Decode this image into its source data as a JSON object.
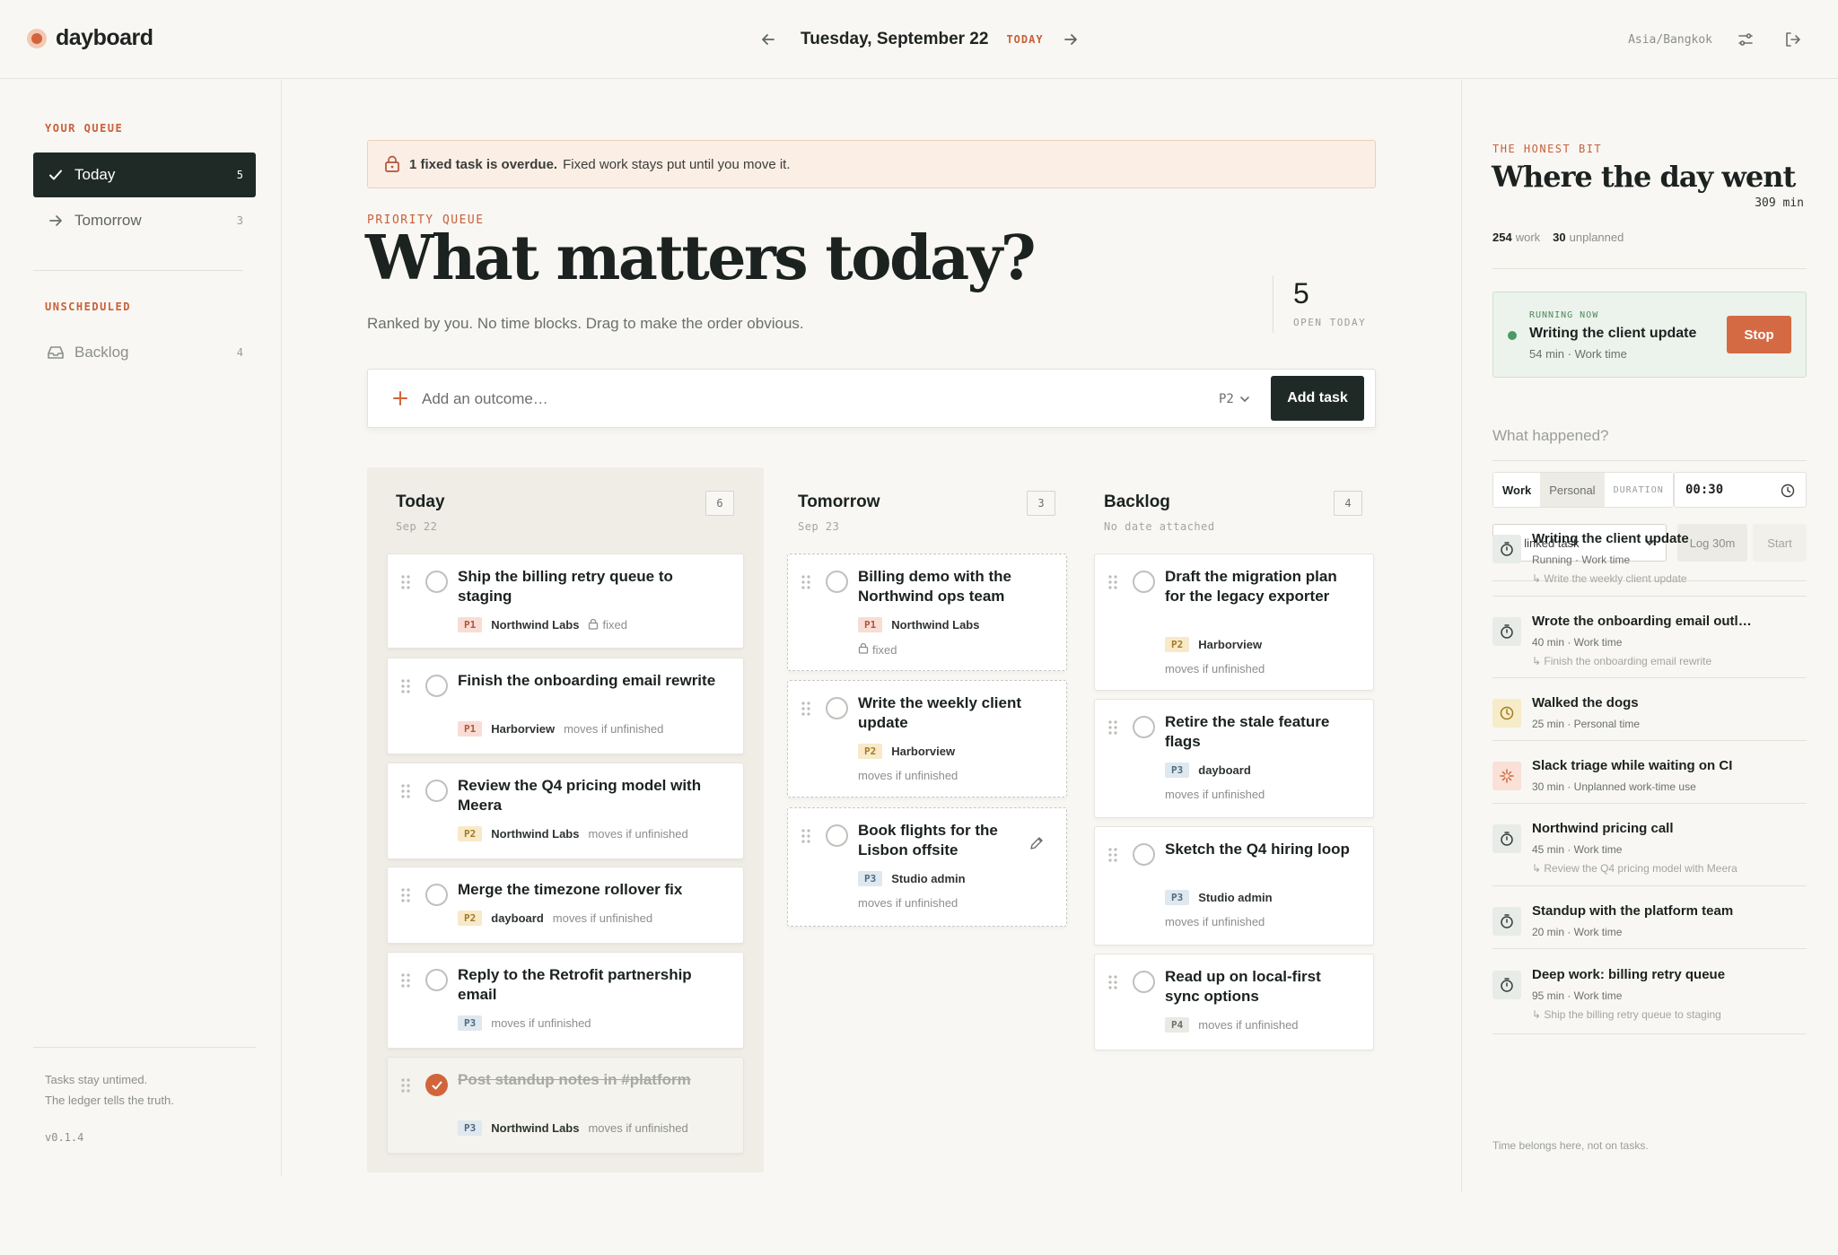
{
  "app": {
    "name": "dayboard"
  },
  "header": {
    "date": "Tuesday, September 22",
    "today_tag": "TODAY",
    "timezone": "Asia/Bangkok"
  },
  "sidebar": {
    "queue_label": "YOUR QUEUE",
    "unscheduled_label": "UNSCHEDULED",
    "items": [
      {
        "label": "Today",
        "count": "5"
      },
      {
        "label": "Tomorrow",
        "count": "3"
      },
      {
        "label": "Backlog",
        "count": "4"
      }
    ],
    "footer_line1": "Tasks stay untimed.",
    "footer_line2": "The ledger tells the truth.",
    "version": "v0.1.4"
  },
  "main": {
    "banner_bold": "1 fixed task is overdue.",
    "banner_text": "Fixed work stays put until you move it.",
    "section_label": "PRIORITY QUEUE",
    "headline": "What matters today?",
    "subline": "Ranked by you. No time blocks. Drag to make the order obvious.",
    "open_count": "5",
    "open_label": "OPEN TODAY",
    "add_placeholder": "Add an outcome…",
    "priority_value": "P2",
    "add_button": "Add task"
  },
  "columns": [
    {
      "title": "Today",
      "sub": "Sep 22",
      "count": "6",
      "cards": [
        {
          "title": "Ship the billing retry queue to staging",
          "priority": "P1",
          "client": "Northwind Labs",
          "note": "fixed"
        },
        {
          "title": "Finish the onboarding email rewrite",
          "priority": "P1",
          "client": "Harborview",
          "note": "moves if unfinished"
        },
        {
          "title": "Review the Q4 pricing model with Meera",
          "priority": "P2",
          "client": "Northwind Labs",
          "note": "moves if unfinished"
        },
        {
          "title": "Merge the timezone rollover fix",
          "priority": "P2",
          "client": "dayboard",
          "note": "moves if unfinished"
        },
        {
          "title": "Reply to the Retrofit partnership email",
          "priority": "P3",
          "client": "",
          "note": "moves if unfinished"
        },
        {
          "title": "Post standup notes in #platform",
          "priority": "P3",
          "client": "Northwind Labs",
          "note": "moves if unfinished"
        }
      ]
    },
    {
      "title": "Tomorrow",
      "sub": "Sep 23",
      "count": "3",
      "cards": [
        {
          "title": "Billing demo with the Northwind ops team",
          "priority": "P1",
          "client": "Northwind Labs",
          "note": "fixed"
        },
        {
          "title": "Write the weekly client update",
          "priority": "P2",
          "client": "Harborview",
          "note": "moves if unfinished"
        },
        {
          "title": "Book flights for the Lisbon offsite",
          "priority": "P3",
          "client": "Studio admin",
          "note": "moves if unfinished"
        }
      ]
    },
    {
      "title": "Backlog",
      "sub": "No date attached",
      "count": "4",
      "cards": [
        {
          "title": "Draft the migration plan for the legacy exporter",
          "priority": "P2",
          "client": "Harborview",
          "note": "moves if unfinished"
        },
        {
          "title": "Retire the stale feature flags",
          "priority": "P3",
          "client": "dayboard",
          "note": "moves if unfinished"
        },
        {
          "title": "Sketch the Q4 hiring loop",
          "priority": "P3",
          "client": "Studio admin",
          "note": "moves if unfinished"
        },
        {
          "title": "Read up on local-first sync options",
          "priority": "P4",
          "client": "",
          "note": "moves if unfinished"
        }
      ]
    }
  ],
  "ledger": {
    "label": "THE HONEST BIT",
    "title": "Where the day went",
    "total": "309 min",
    "work_num": "254",
    "work_lbl": "work",
    "unplanned_num": "30",
    "unplanned_lbl": "unplanned",
    "running_label": "RUNNING NOW",
    "running_title": "Writing the client update",
    "running_sub": "54 min · Work time",
    "stop": "Stop",
    "what_placeholder": "What happened?",
    "seg_work": "Work",
    "seg_personal": "Personal",
    "duration_label": "DURATION",
    "duration_value": "00:30",
    "linked_task": "No linked task",
    "log_button": "Log 30m",
    "start_button": "Start",
    "entries": [
      {
        "title": "Writing the client update",
        "sub": "Running · Work time",
        "link": "↳ Write the weekly client update",
        "kind": "work"
      },
      {
        "title": "Wrote the onboarding email outl…",
        "sub": "40 min · Work time",
        "link": "↳ Finish the onboarding email rewrite",
        "kind": "work"
      },
      {
        "title": "Walked the dogs",
        "sub": "25 min · Personal time",
        "link": "",
        "kind": "personal"
      },
      {
        "title": "Slack triage while waiting on CI",
        "sub": "30 min · Unplanned work-time use",
        "link": "",
        "kind": "unplanned"
      },
      {
        "title": "Northwind pricing call",
        "sub": "45 min · Work time",
        "link": "↳ Review the Q4 pricing model with Meera",
        "kind": "work"
      },
      {
        "title": "Standup with the platform team",
        "sub": "20 min · Work time",
        "link": "",
        "kind": "work"
      },
      {
        "title": "Deep work: billing retry queue",
        "sub": "95 min · Work time",
        "link": "↳ Ship the billing retry queue to staging",
        "kind": "work"
      }
    ],
    "footer": "Time belongs here, not on tasks."
  },
  "colors": {
    "accent": "#d2643c",
    "dark": "#1f2a26",
    "running_green": "#4c9a5e"
  }
}
